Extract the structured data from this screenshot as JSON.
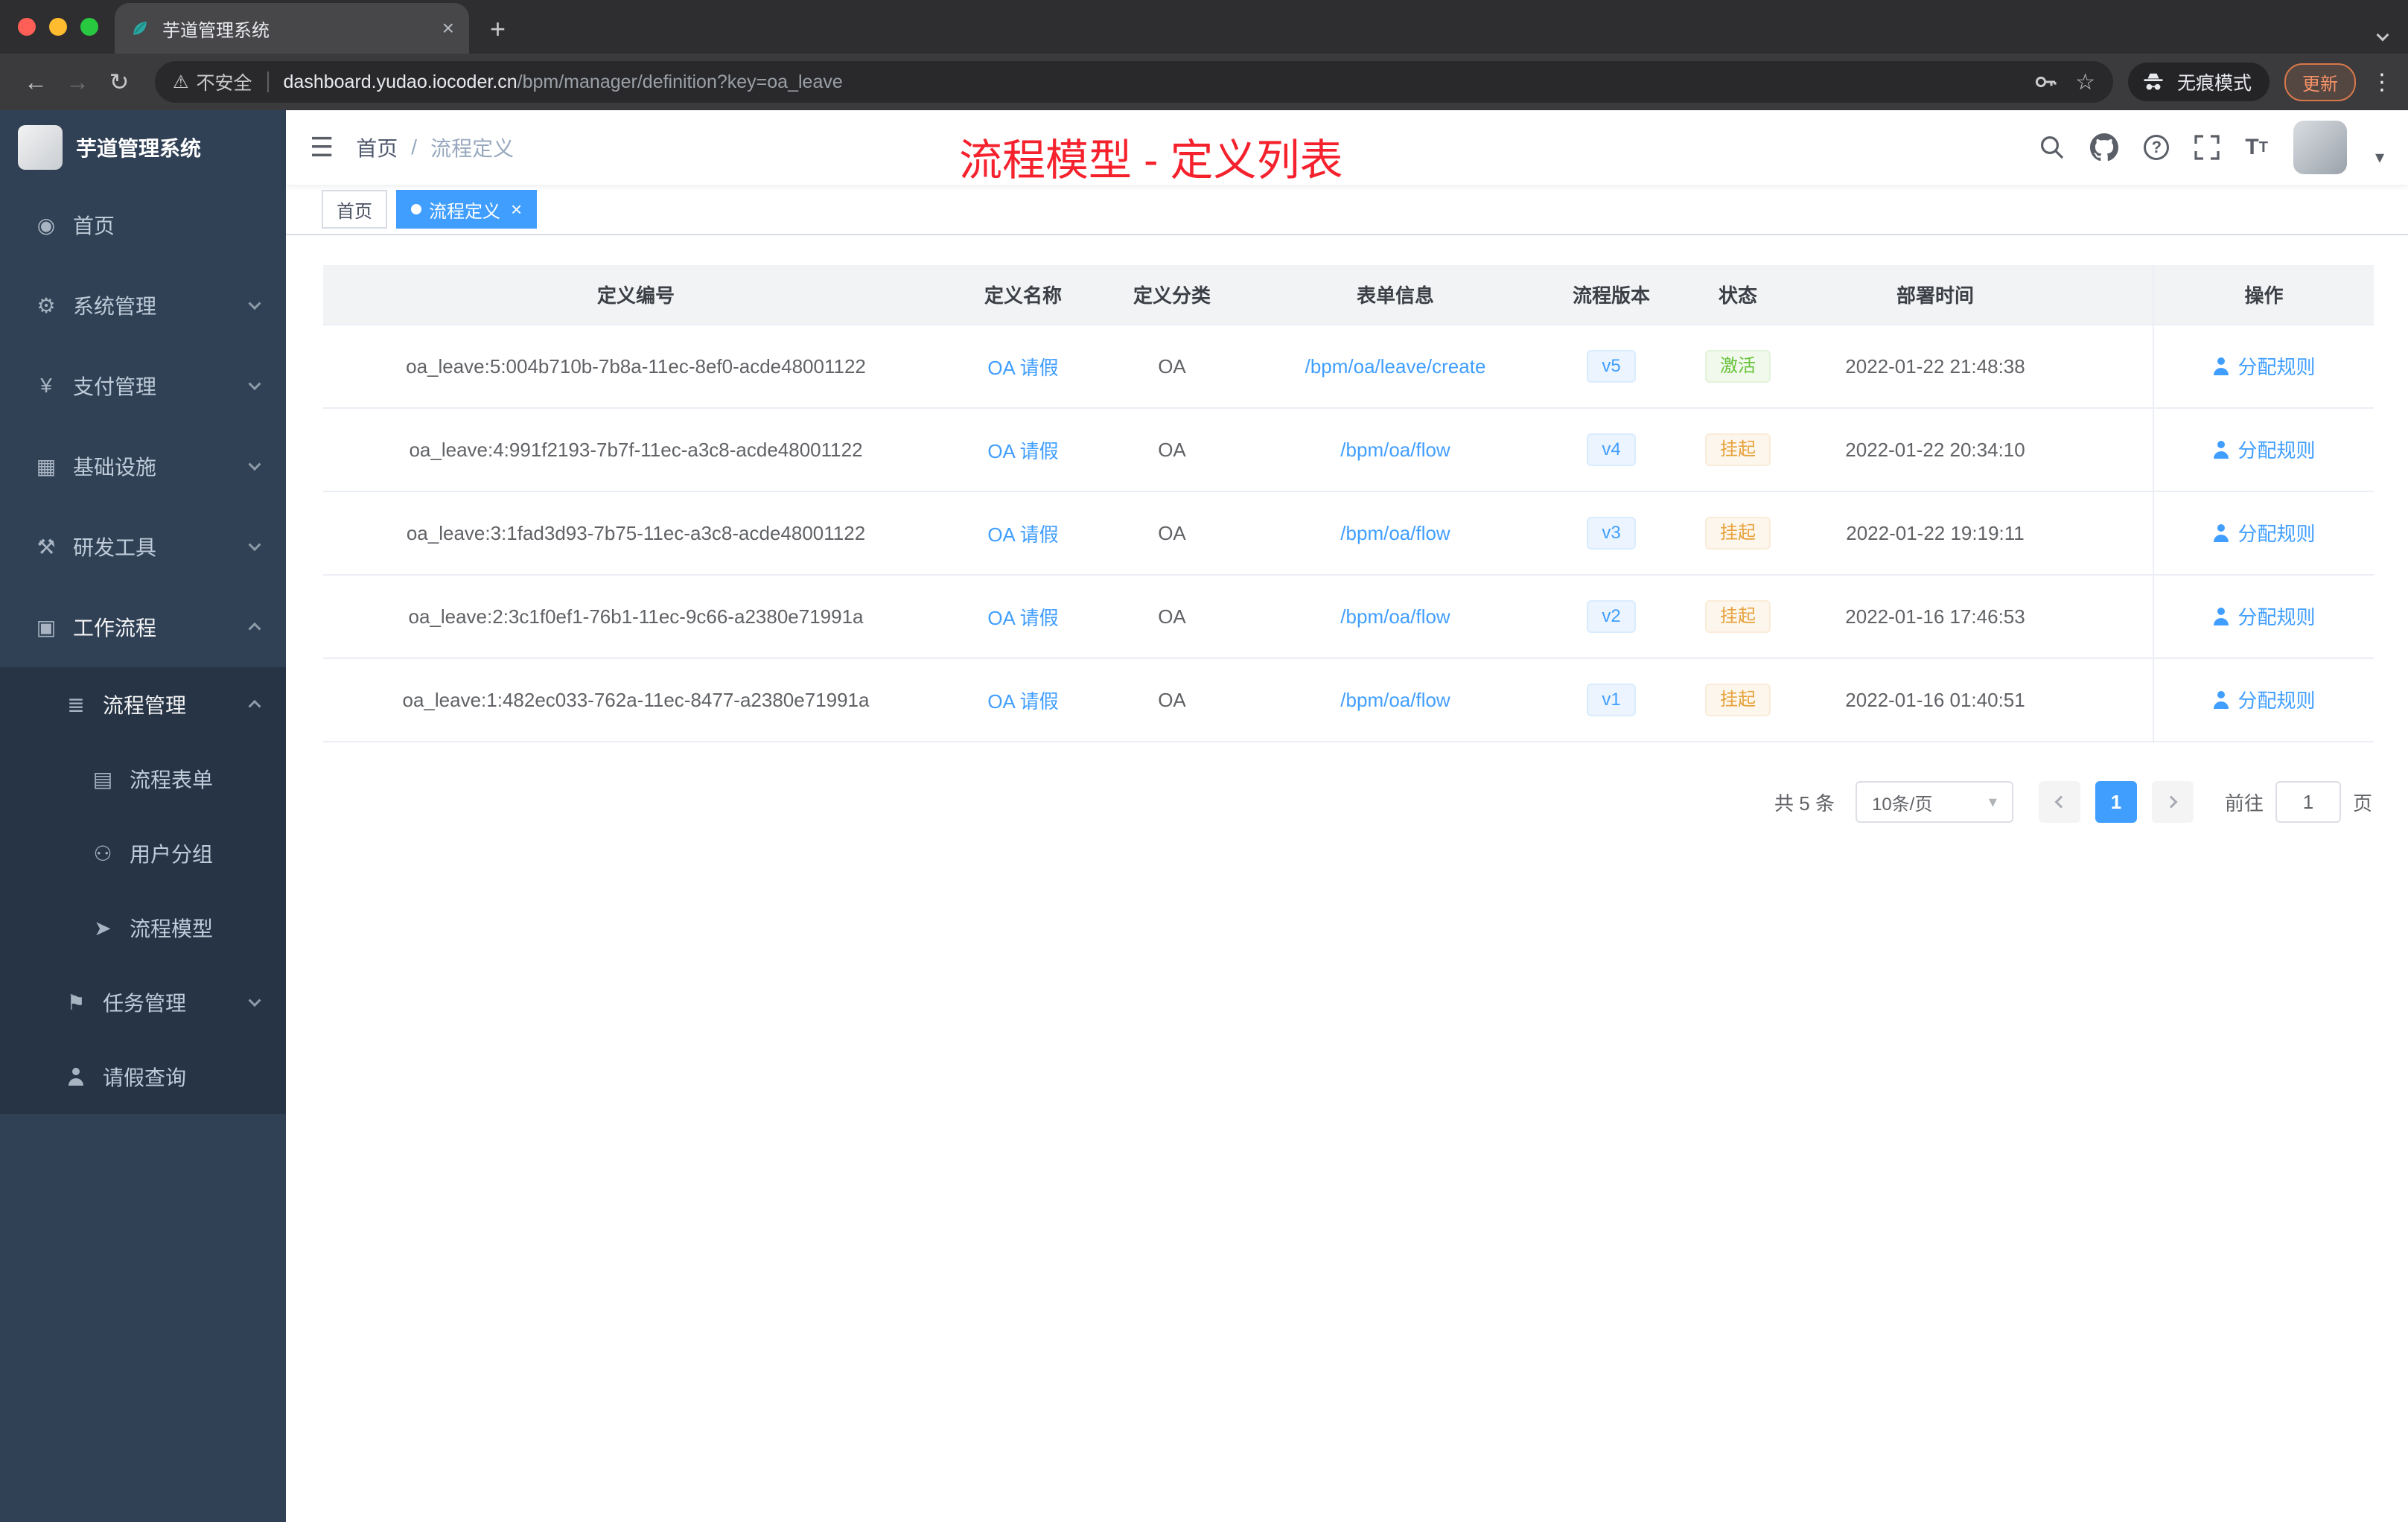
{
  "browser": {
    "tab_title": "芋道管理系统",
    "security_label": "不安全",
    "url_host": "dashboard.yudao.iocoder.cn",
    "url_path": "/bpm/manager/definition?key=oa_leave",
    "incognito_label": "无痕模式",
    "update_label": "更新"
  },
  "sidebar": {
    "logo_title": "芋道管理系统",
    "items": [
      {
        "label": "首页",
        "level": 1
      },
      {
        "label": "系统管理",
        "level": 1
      },
      {
        "label": "支付管理",
        "level": 1
      },
      {
        "label": "基础设施",
        "level": 1
      },
      {
        "label": "研发工具",
        "level": 1
      },
      {
        "label": "工作流程",
        "level": 1
      },
      {
        "label": "流程管理",
        "level": 2
      },
      {
        "label": "流程表单",
        "level": 3
      },
      {
        "label": "用户分组",
        "level": 3
      },
      {
        "label": "流程模型",
        "level": 3
      },
      {
        "label": "任务管理",
        "level": 2
      },
      {
        "label": "请假查询",
        "level": 2
      }
    ]
  },
  "header": {
    "breadcrumb_home": "首页",
    "breadcrumb_sep": "/",
    "breadcrumb_current": "流程定义",
    "overlay_title": "流程模型 - 定义列表"
  },
  "tags": {
    "home": "首页",
    "active": "流程定义"
  },
  "table": {
    "columns": [
      "定义编号",
      "定义名称",
      "定义分类",
      "表单信息",
      "流程版本",
      "状态",
      "部署时间",
      "操作"
    ],
    "rows": [
      {
        "id": "oa_leave:5:004b710b-7b8a-11ec-8ef0-acde48001122",
        "name": "OA 请假",
        "category": "OA",
        "form": "/bpm/oa/leave/create",
        "version": "v5",
        "status": "激活",
        "deployed_at": "2022-01-22 21:48:38",
        "action": "分配规则"
      },
      {
        "id": "oa_leave:4:991f2193-7b7f-11ec-a3c8-acde48001122",
        "name": "OA 请假",
        "category": "OA",
        "form": "/bpm/oa/flow",
        "version": "v4",
        "status": "挂起",
        "deployed_at": "2022-01-22 20:34:10",
        "action": "分配规则"
      },
      {
        "id": "oa_leave:3:1fad3d93-7b75-11ec-a3c8-acde48001122",
        "name": "OA 请假",
        "category": "OA",
        "form": "/bpm/oa/flow",
        "version": "v3",
        "status": "挂起",
        "deployed_at": "2022-01-22 19:19:11",
        "action": "分配规则"
      },
      {
        "id": "oa_leave:2:3c1f0ef1-76b1-11ec-9c66-a2380e71991a",
        "name": "OA 请假",
        "category": "OA",
        "form": "/bpm/oa/flow",
        "version": "v2",
        "status": "挂起",
        "deployed_at": "2022-01-16 17:46:53",
        "action": "分配规则"
      },
      {
        "id": "oa_leave:1:482ec033-762a-11ec-8477-a2380e71991a",
        "name": "OA 请假",
        "category": "OA",
        "form": "/bpm/oa/flow",
        "version": "v1",
        "status": "挂起",
        "deployed_at": "2022-01-16 01:40:51",
        "action": "分配规则"
      }
    ]
  },
  "pagination": {
    "total": "共 5 条",
    "page_size": "10条/页",
    "current": "1",
    "goto_label": "前往",
    "goto_value": "1",
    "page_unit": "页"
  },
  "icons": {
    "dashboard": "◉",
    "system": "⚙",
    "payment": "¥",
    "infra": "▦",
    "devtools": "⚒",
    "workflow": "▣",
    "process_manage": "≣",
    "process_form": "▤",
    "user_group": "⚇",
    "process_model": "➤",
    "task_manage": "⚑",
    "hamburger": "☰",
    "warning": "⚠",
    "star": "☆",
    "back": "←",
    "forward": "→",
    "reload": "↻",
    "kebab": "⋮",
    "close": "×",
    "plus": "+",
    "question": "?",
    "caret_down": "▾"
  },
  "colors": {
    "accent": "#409eff",
    "annotation_red": "#f5222d",
    "success": "#67c23a",
    "warning": "#e6a23c",
    "sidebar_bg": "#304156"
  }
}
